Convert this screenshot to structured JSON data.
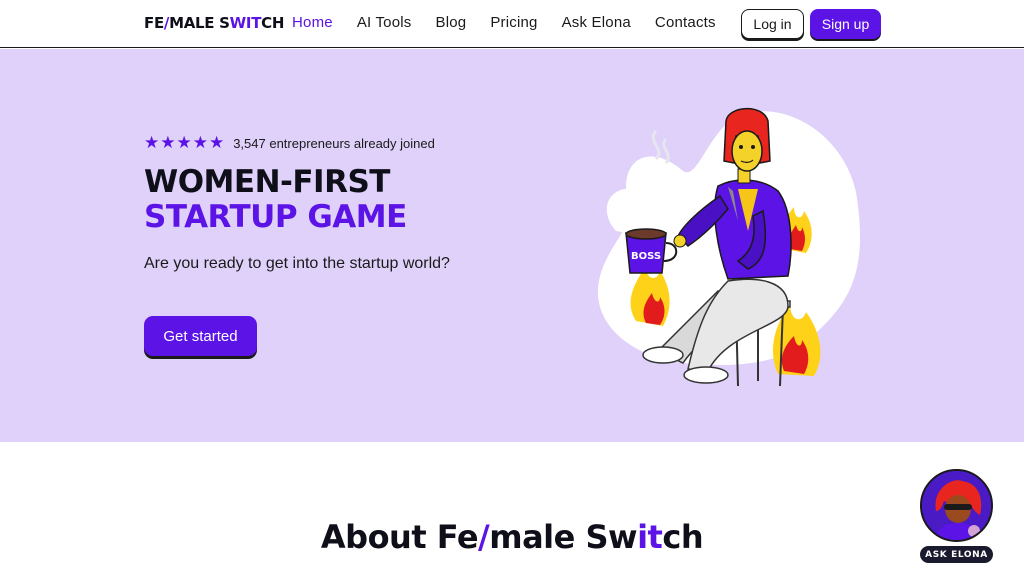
{
  "header": {
    "logo": {
      "part1": "FE",
      "slash": "/",
      "part2": "MALE S",
      "accent": "WIT",
      "part3": "CH"
    },
    "nav": [
      {
        "label": "Home",
        "active": true
      },
      {
        "label": "AI Tools",
        "active": false
      },
      {
        "label": "Blog",
        "active": false
      },
      {
        "label": "Pricing",
        "active": false
      },
      {
        "label": "Ask Elona",
        "active": false
      },
      {
        "label": "Contacts",
        "active": false
      }
    ],
    "login_label": "Log in",
    "signup_label": "Sign up"
  },
  "hero": {
    "stars": "★★★★★",
    "rating_text": "3,547 entrepreneurs already joined",
    "title_line1": "WOMEN-FIRST",
    "title_line2": "STARTUP GAME",
    "subtitle": "Are you ready to get into the startup world?",
    "cta_label": "Get started",
    "mug_text": "BOSS"
  },
  "about": {
    "title_part1": "About Fe",
    "title_slash": "/",
    "title_part2": "male Sw",
    "title_accent": "it",
    "title_part3": "ch"
  },
  "chat_widget": {
    "badge_label": "ASK ELONA"
  },
  "colors": {
    "brand_purple": "#5b13e6",
    "hero_bg": "#e0d1fb",
    "text_dark": "#0f0f1a"
  }
}
